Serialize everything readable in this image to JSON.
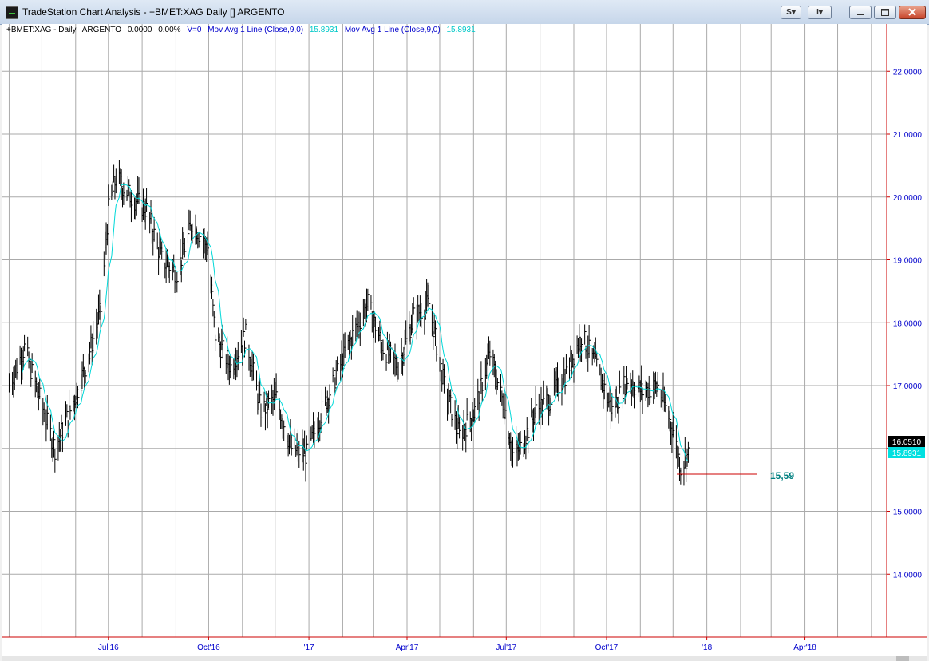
{
  "window": {
    "title": "TradeStation Chart Analysis - +BMET:XAG Daily [] ARGENTO",
    "btn_s": "S",
    "btn_i": "I"
  },
  "status": {
    "symbol": "+BMET:XAG - Daily",
    "description": "ARGENTO",
    "change": "0.0000",
    "change_pct": "0.00%",
    "volume": "V=0",
    "indicator1": "Mov Avg 1 Line (Close,9,0)",
    "indicator1_value": "15.8931",
    "indicator2": "Mov Avg 1 Line (Close,9,0)",
    "indicator2_value": "15.8931"
  },
  "colors": {
    "price_bars": "#000000",
    "moving_average": "#00d8d8",
    "grid": "#aaaaaa",
    "axis": "#cc0000",
    "last_price_box": "#000000",
    "ma_box": "#00e0e0",
    "annotation": "#008080"
  },
  "chart_data": {
    "type": "line",
    "y_axis": {
      "side": "right",
      "range": [
        13.0,
        22.6
      ],
      "ticks": [
        "22.0000",
        "21.0000",
        "20.0000",
        "19.0000",
        "18.0000",
        "17.0000",
        "16.0000",
        "15.0000",
        "14.0000"
      ],
      "tick_values": [
        22,
        21,
        20,
        19,
        18,
        17,
        16,
        15,
        14
      ]
    },
    "x_axis": {
      "labels": [
        "Jul'16",
        "Oct'16",
        "'17",
        "Apr'17",
        "Jul'17",
        "Oct'17",
        "'18",
        "Apr'18"
      ]
    },
    "grid": true,
    "price_series": {
      "name": "+BMET:XAG",
      "dates": [
        "2016-04-01",
        "2016-04-15",
        "2016-04-29",
        "2016-05-13",
        "2016-05-27",
        "2016-06-10",
        "2016-06-24",
        "2016-07-01",
        "2016-07-08",
        "2016-07-22",
        "2016-08-05",
        "2016-08-19",
        "2016-09-02",
        "2016-09-16",
        "2016-09-30",
        "2016-10-07",
        "2016-10-21",
        "2016-11-04",
        "2016-11-18",
        "2016-12-02",
        "2016-12-16",
        "2016-12-30",
        "2017-01-13",
        "2017-01-27",
        "2017-02-10",
        "2017-02-24",
        "2017-03-10",
        "2017-03-24",
        "2017-04-07",
        "2017-04-21",
        "2017-05-05",
        "2017-05-19",
        "2017-06-02",
        "2017-06-16",
        "2017-06-30",
        "2017-07-07",
        "2017-07-14",
        "2017-07-28",
        "2017-08-11",
        "2017-08-25",
        "2017-09-08",
        "2017-09-22",
        "2017-10-06",
        "2017-10-20",
        "2017-11-03",
        "2017-11-17",
        "2017-12-01",
        "2017-12-08",
        "2017-12-15"
      ],
      "close": [
        17.0,
        17.6,
        16.8,
        16.0,
        16.6,
        17.3,
        18.2,
        19.8,
        20.3,
        20.0,
        19.8,
        19.0,
        18.8,
        19.6,
        19.2,
        17.8,
        17.3,
        17.8,
        16.6,
        16.8,
        16.0,
        15.9,
        16.6,
        17.2,
        17.8,
        18.3,
        17.6,
        17.3,
        18.1,
        18.3,
        17.0,
        16.2,
        16.6,
        17.5,
        16.6,
        15.9,
        16.0,
        16.6,
        16.8,
        17.2,
        17.8,
        17.3,
        16.6,
        17.1,
        16.9,
        17.0,
        16.3,
        15.7,
        15.9
      ]
    },
    "moving_average": {
      "name": "Mov Avg 1 Line (Close,9,0)",
      "last_value": 15.8931
    },
    "last_price": "16.0510",
    "ma_label": "15.8931",
    "support_annotation": {
      "label": "15,59",
      "price": 15.59
    }
  }
}
